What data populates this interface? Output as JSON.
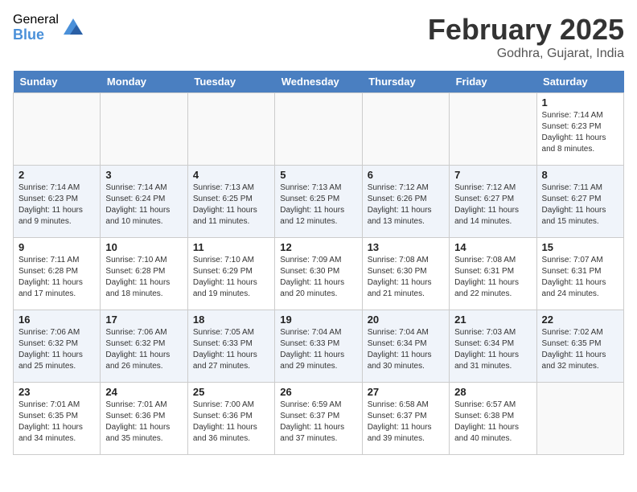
{
  "logo": {
    "general": "General",
    "blue": "Blue"
  },
  "title": "February 2025",
  "subtitle": "Godhra, Gujarat, India",
  "days_of_week": [
    "Sunday",
    "Monday",
    "Tuesday",
    "Wednesday",
    "Thursday",
    "Friday",
    "Saturday"
  ],
  "weeks": [
    [
      {
        "day": "",
        "info": ""
      },
      {
        "day": "",
        "info": ""
      },
      {
        "day": "",
        "info": ""
      },
      {
        "day": "",
        "info": ""
      },
      {
        "day": "",
        "info": ""
      },
      {
        "day": "",
        "info": ""
      },
      {
        "day": "1",
        "info": "Sunrise: 7:14 AM\nSunset: 6:23 PM\nDaylight: 11 hours and 8 minutes."
      }
    ],
    [
      {
        "day": "2",
        "info": "Sunrise: 7:14 AM\nSunset: 6:23 PM\nDaylight: 11 hours and 9 minutes."
      },
      {
        "day": "3",
        "info": "Sunrise: 7:14 AM\nSunset: 6:24 PM\nDaylight: 11 hours and 10 minutes."
      },
      {
        "day": "4",
        "info": "Sunrise: 7:13 AM\nSunset: 6:25 PM\nDaylight: 11 hours and 11 minutes."
      },
      {
        "day": "5",
        "info": "Sunrise: 7:13 AM\nSunset: 6:25 PM\nDaylight: 11 hours and 12 minutes."
      },
      {
        "day": "6",
        "info": "Sunrise: 7:12 AM\nSunset: 6:26 PM\nDaylight: 11 hours and 13 minutes."
      },
      {
        "day": "7",
        "info": "Sunrise: 7:12 AM\nSunset: 6:27 PM\nDaylight: 11 hours and 14 minutes."
      },
      {
        "day": "8",
        "info": "Sunrise: 7:11 AM\nSunset: 6:27 PM\nDaylight: 11 hours and 15 minutes."
      }
    ],
    [
      {
        "day": "9",
        "info": "Sunrise: 7:11 AM\nSunset: 6:28 PM\nDaylight: 11 hours and 17 minutes."
      },
      {
        "day": "10",
        "info": "Sunrise: 7:10 AM\nSunset: 6:28 PM\nDaylight: 11 hours and 18 minutes."
      },
      {
        "day": "11",
        "info": "Sunrise: 7:10 AM\nSunset: 6:29 PM\nDaylight: 11 hours and 19 minutes."
      },
      {
        "day": "12",
        "info": "Sunrise: 7:09 AM\nSunset: 6:30 PM\nDaylight: 11 hours and 20 minutes."
      },
      {
        "day": "13",
        "info": "Sunrise: 7:08 AM\nSunset: 6:30 PM\nDaylight: 11 hours and 21 minutes."
      },
      {
        "day": "14",
        "info": "Sunrise: 7:08 AM\nSunset: 6:31 PM\nDaylight: 11 hours and 22 minutes."
      },
      {
        "day": "15",
        "info": "Sunrise: 7:07 AM\nSunset: 6:31 PM\nDaylight: 11 hours and 24 minutes."
      }
    ],
    [
      {
        "day": "16",
        "info": "Sunrise: 7:06 AM\nSunset: 6:32 PM\nDaylight: 11 hours and 25 minutes."
      },
      {
        "day": "17",
        "info": "Sunrise: 7:06 AM\nSunset: 6:32 PM\nDaylight: 11 hours and 26 minutes."
      },
      {
        "day": "18",
        "info": "Sunrise: 7:05 AM\nSunset: 6:33 PM\nDaylight: 11 hours and 27 minutes."
      },
      {
        "day": "19",
        "info": "Sunrise: 7:04 AM\nSunset: 6:33 PM\nDaylight: 11 hours and 29 minutes."
      },
      {
        "day": "20",
        "info": "Sunrise: 7:04 AM\nSunset: 6:34 PM\nDaylight: 11 hours and 30 minutes."
      },
      {
        "day": "21",
        "info": "Sunrise: 7:03 AM\nSunset: 6:34 PM\nDaylight: 11 hours and 31 minutes."
      },
      {
        "day": "22",
        "info": "Sunrise: 7:02 AM\nSunset: 6:35 PM\nDaylight: 11 hours and 32 minutes."
      }
    ],
    [
      {
        "day": "23",
        "info": "Sunrise: 7:01 AM\nSunset: 6:35 PM\nDaylight: 11 hours and 34 minutes."
      },
      {
        "day": "24",
        "info": "Sunrise: 7:01 AM\nSunset: 6:36 PM\nDaylight: 11 hours and 35 minutes."
      },
      {
        "day": "25",
        "info": "Sunrise: 7:00 AM\nSunset: 6:36 PM\nDaylight: 11 hours and 36 minutes."
      },
      {
        "day": "26",
        "info": "Sunrise: 6:59 AM\nSunset: 6:37 PM\nDaylight: 11 hours and 37 minutes."
      },
      {
        "day": "27",
        "info": "Sunrise: 6:58 AM\nSunset: 6:37 PM\nDaylight: 11 hours and 39 minutes."
      },
      {
        "day": "28",
        "info": "Sunrise: 6:57 AM\nSunset: 6:38 PM\nDaylight: 11 hours and 40 minutes."
      },
      {
        "day": "",
        "info": ""
      }
    ]
  ]
}
